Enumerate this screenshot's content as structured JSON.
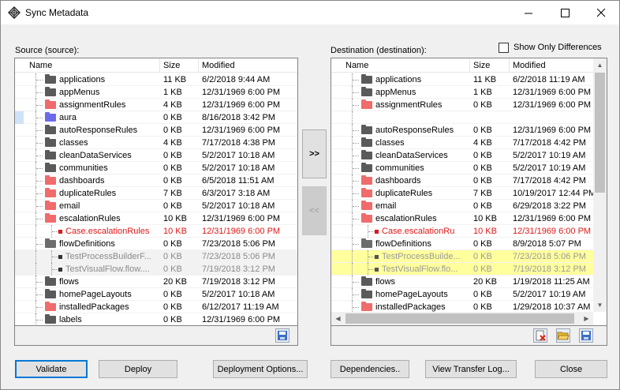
{
  "window": {
    "title": "Sync Metadata",
    "minimize": "—",
    "maximize": "☐",
    "close": "✕"
  },
  "source": {
    "label": "Source (source):",
    "columns": [
      "Name",
      "Size",
      "Modified"
    ],
    "rows": [
      {
        "name": "applications",
        "size": "11 KB",
        "modified": "6/2/2018 9:44 AM",
        "icon": "dark",
        "style": ""
      },
      {
        "name": "appMenus",
        "size": "1 KB",
        "modified": "12/31/1969 6:00 PM",
        "icon": "dark",
        "style": ""
      },
      {
        "name": "assignmentRules",
        "size": "4 KB",
        "modified": "12/31/1969 6:00 PM",
        "icon": "red",
        "style": ""
      },
      {
        "name": "aura",
        "size": "0 KB",
        "modified": "8/16/2018 3:42 PM",
        "icon": "blue",
        "style": "blue"
      },
      {
        "name": "autoResponseRules",
        "size": "0 KB",
        "modified": "12/31/1969 6:00 PM",
        "icon": "dark",
        "style": ""
      },
      {
        "name": "classes",
        "size": "4 KB",
        "modified": "7/17/2018 4:38 PM",
        "icon": "dark",
        "style": ""
      },
      {
        "name": "cleanDataServices",
        "size": "0 KB",
        "modified": "5/2/2017 10:18 AM",
        "icon": "dark",
        "style": ""
      },
      {
        "name": "communities",
        "size": "0 KB",
        "modified": "5/2/2017 10:18 AM",
        "icon": "dark",
        "style": ""
      },
      {
        "name": "dashboards",
        "size": "0 KB",
        "modified": "6/5/2018 11:51 AM",
        "icon": "red",
        "style": ""
      },
      {
        "name": "duplicateRules",
        "size": "7 KB",
        "modified": "6/3/2017 3:18 AM",
        "icon": "red",
        "style": ""
      },
      {
        "name": "email",
        "size": "0 KB",
        "modified": "5/2/2017 10:18 AM",
        "icon": "red",
        "style": ""
      },
      {
        "name": "escalationRules",
        "size": "10 KB",
        "modified": "12/31/1969 6:00 PM",
        "icon": "red-open",
        "style": ""
      },
      {
        "name": "Case.escalationRules",
        "size": "10 KB",
        "modified": "12/31/1969 6:00 PM",
        "icon": "file-red",
        "style": "red"
      },
      {
        "name": "flowDefinitions",
        "size": "0 KB",
        "modified": "7/23/2018 5:06 PM",
        "icon": "open",
        "style": ""
      },
      {
        "name": "TestProcessBuilderF...",
        "size": "0 KB",
        "modified": "7/23/2018 5:06 PM",
        "icon": "file-dark",
        "style": "grey"
      },
      {
        "name": "TestVisualFlow.flow....",
        "size": "0 KB",
        "modified": "7/19/2018 3:12 PM",
        "icon": "file-dark",
        "style": "grey"
      },
      {
        "name": "flows",
        "size": "20 KB",
        "modified": "7/19/2018 3:12 PM",
        "icon": "dark",
        "style": ""
      },
      {
        "name": "homePageLayouts",
        "size": "0 KB",
        "modified": "5/2/2017 10:18 AM",
        "icon": "dark",
        "style": ""
      },
      {
        "name": "installedPackages",
        "size": "0 KB",
        "modified": "6/12/2017 11:19 AM",
        "icon": "red",
        "style": ""
      },
      {
        "name": "labels",
        "size": "0 KB",
        "modified": "12/31/1969 6:00 PM",
        "icon": "dark",
        "style": ""
      }
    ]
  },
  "destination": {
    "label": "Destination (destination):",
    "show_only_differences": "Show Only Differences",
    "columns": [
      "Name",
      "Size",
      "Modified"
    ],
    "rows": [
      {
        "name": "applications",
        "size": "11 KB",
        "modified": "6/2/2018 11:19 AM",
        "icon": "dark",
        "style": ""
      },
      {
        "name": "appMenus",
        "size": "1 KB",
        "modified": "12/31/1969 6:00 PM",
        "icon": "dark",
        "style": ""
      },
      {
        "name": "assignmentRules",
        "size": "0 KB",
        "modified": "12/31/1969 6:00 PM",
        "icon": "red",
        "style": ""
      },
      {
        "name": "",
        "size": "",
        "modified": "",
        "icon": "none",
        "style": "blank"
      },
      {
        "name": "autoResponseRules",
        "size": "0 KB",
        "modified": "12/31/1969 6:00 PM",
        "icon": "dark",
        "style": ""
      },
      {
        "name": "classes",
        "size": "4 KB",
        "modified": "7/17/2018 4:42 PM",
        "icon": "dark",
        "style": ""
      },
      {
        "name": "cleanDataServices",
        "size": "0 KB",
        "modified": "5/2/2017 10:19 AM",
        "icon": "dark",
        "style": ""
      },
      {
        "name": "communities",
        "size": "0 KB",
        "modified": "5/2/2017 10:19 AM",
        "icon": "dark",
        "style": ""
      },
      {
        "name": "dashboards",
        "size": "0 KB",
        "modified": "7/17/2018 4:42 PM",
        "icon": "red",
        "style": ""
      },
      {
        "name": "duplicateRules",
        "size": "7 KB",
        "modified": "10/19/2017 12:44 PM",
        "icon": "red",
        "style": ""
      },
      {
        "name": "email",
        "size": "0 KB",
        "modified": "6/29/2018 3:22 PM",
        "icon": "red",
        "style": ""
      },
      {
        "name": "escalationRules",
        "size": "10 KB",
        "modified": "12/31/1969 6:00 PM",
        "icon": "red-open",
        "style": ""
      },
      {
        "name": "Case.escalationRu",
        "size": "10 KB",
        "modified": "12/31/1969 6:00 PM",
        "icon": "file-red",
        "style": "red"
      },
      {
        "name": "flowDefinitions",
        "size": "0 KB",
        "modified": "8/9/2018 5:07 PM",
        "icon": "open",
        "style": ""
      },
      {
        "name": "TestProcessBuilde...",
        "size": "0 KB",
        "modified": "7/23/2018 5:06 PM",
        "icon": "file-olive",
        "style": "yellow"
      },
      {
        "name": "TestVisualFlow.flo...",
        "size": "0 KB",
        "modified": "7/19/2018 3:12 PM",
        "icon": "file-olive",
        "style": "yellow"
      },
      {
        "name": "flows",
        "size": "20 KB",
        "modified": "1/19/2018 11:25 AM",
        "icon": "dark",
        "style": ""
      },
      {
        "name": "homePageLayouts",
        "size": "0 KB",
        "modified": "5/2/2017 10:19 AM",
        "icon": "dark",
        "style": ""
      },
      {
        "name": "installedPackages",
        "size": "0 KB",
        "modified": "1/29/2018 10:37 AM",
        "icon": "red",
        "style": ""
      }
    ]
  },
  "transfer": {
    "to_destination": ">>",
    "to_source": "<<"
  },
  "buttons": {
    "validate": "Validate",
    "deploy": "Deploy",
    "deployment_options": "Deployment Options...",
    "dependencies": "Dependencies..",
    "view_transfer_log": "View Transfer Log...",
    "close": "Close"
  }
}
